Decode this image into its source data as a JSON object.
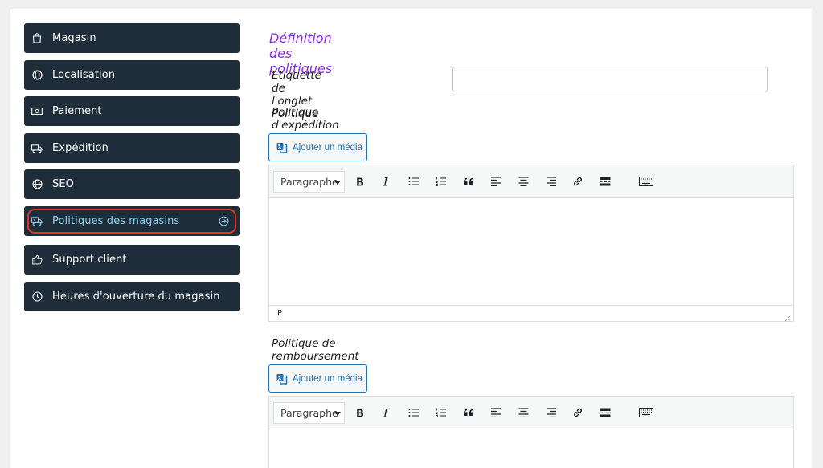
{
  "sidebar": {
    "items": [
      {
        "label": "Magasin",
        "icon": "bag-icon"
      },
      {
        "label": "Localisation",
        "icon": "globe-icon"
      },
      {
        "label": "Paiement",
        "icon": "money-icon"
      },
      {
        "label": "Expédition",
        "icon": "truck-icon"
      },
      {
        "label": "SEO",
        "icon": "globe-icon"
      },
      {
        "label": "Politiques des magasins",
        "icon": "policy-truck-icon",
        "active": true
      },
      {
        "label": "Support client",
        "icon": "thumbs-up-icon"
      },
      {
        "label": "Heures d'ouverture du magasin",
        "icon": "clock-icon"
      }
    ]
  },
  "main": {
    "section_title": "Définition des politiques",
    "tab_label_field": {
      "label": "Étiquette de l'onglet Politique",
      "value": ""
    },
    "shipping_policy": {
      "label": "Politique d'expédition",
      "media_button": "Ajouter un média",
      "format_select": "Paragraphe",
      "status_path": "P",
      "content": ""
    },
    "refund_policy": {
      "label": "Politique de remboursement",
      "media_button": "Ajouter un média",
      "format_select": "Paragraphe"
    }
  },
  "colors": {
    "nav_bg": "#1f2d3a",
    "active_label": "#8fd3f0",
    "highlight_ring": "#e03a1e",
    "title": "#8a2be2",
    "link_blue": "#2271b1"
  }
}
